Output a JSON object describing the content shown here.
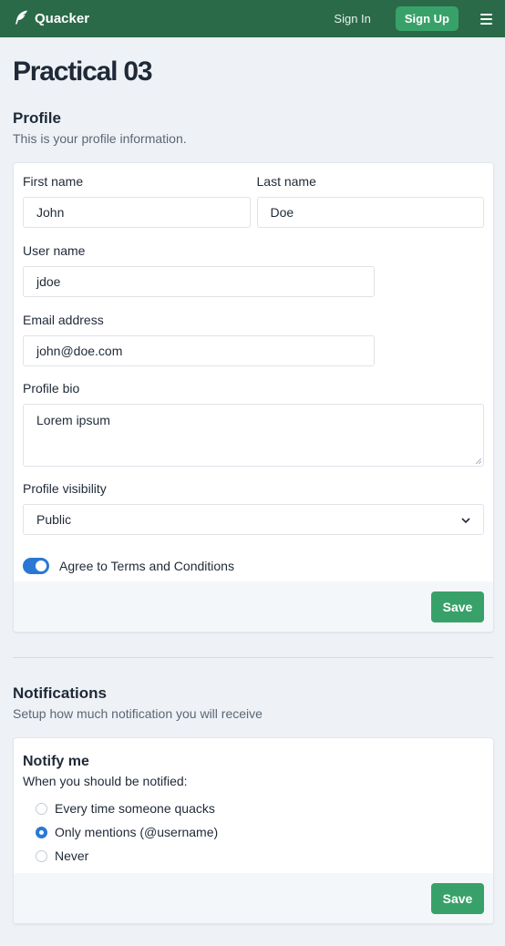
{
  "navbar": {
    "brand": "Quacker",
    "signin_label": "Sign In",
    "signup_label": "Sign Up",
    "accent_color": "#2a6a48"
  },
  "page": {
    "title": "Practical 03"
  },
  "profile": {
    "title": "Profile",
    "description": "This is your profile information.",
    "first_name_label": "First name",
    "first_name_value": "John",
    "last_name_label": "Last name",
    "last_name_value": "Doe",
    "username_label": "User name",
    "username_value": "jdoe",
    "email_label": "Email address",
    "email_value": "john@doe.com",
    "bio_label": "Profile bio",
    "bio_value": "Lorem ipsum",
    "visibility_label": "Profile visibility",
    "visibility_value": "Public",
    "terms_label": "Agree to Terms and Conditions",
    "terms_checked": true,
    "save_label": "Save"
  },
  "notifications": {
    "title": "Notifications",
    "description": "Setup how much notification you will receive",
    "card_title": "Notify me",
    "card_subtitle": "When you should be notified:",
    "options": [
      {
        "label": "Every time someone quacks",
        "checked": false
      },
      {
        "label": "Only mentions (@username)",
        "checked": true
      },
      {
        "label": "Never",
        "checked": false
      }
    ],
    "save_label": "Save"
  }
}
